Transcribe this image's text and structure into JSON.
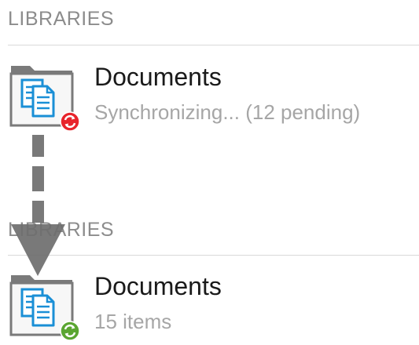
{
  "top": {
    "section_header": "LIBRARIES",
    "library": {
      "title": "Documents",
      "status": "Synchronizing... (12 pending)",
      "icon": "document-library-folder-icon",
      "badge_icon": "sync-error-icon",
      "badge_color": "#e8242b"
    }
  },
  "bottom": {
    "section_header": "LIBRARIES",
    "library": {
      "title": "Documents",
      "status": "15 items",
      "icon": "document-library-folder-icon",
      "badge_icon": "sync-ok-icon",
      "badge_color": "#5aa531"
    }
  },
  "colors": {
    "header_text": "#8c8c8c",
    "title_text": "#1a1a1a",
    "status_text": "#a6a6a6",
    "folder_gray": "#757575",
    "document_blue": "#1a8fd6",
    "arrow_gray": "#6e6e6e"
  }
}
